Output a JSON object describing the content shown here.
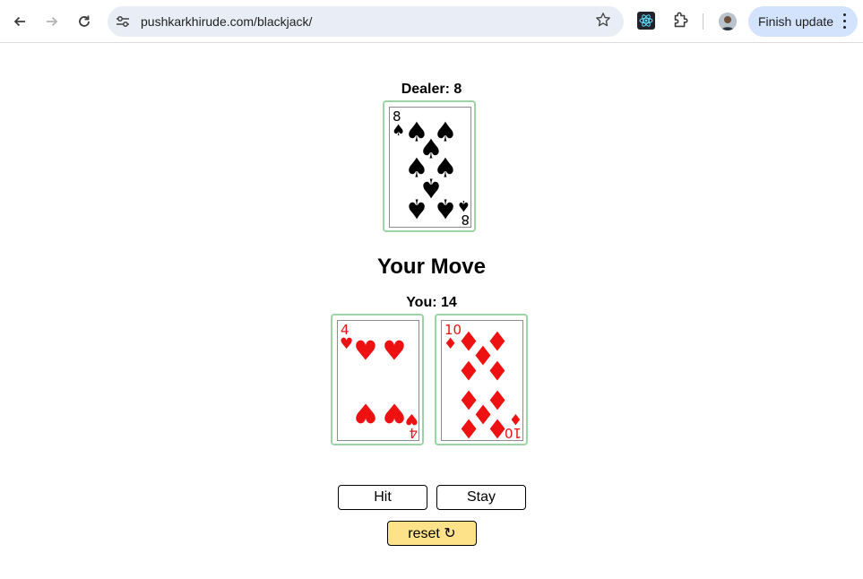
{
  "browser": {
    "url": "pushkarkhirude.com/blackjack/",
    "finish_update_label": "Finish update",
    "icons": [
      "back-icon",
      "forward-icon",
      "reload-icon",
      "site-settings-icon",
      "star-icon",
      "react-devtools-icon",
      "extensions-icon",
      "avatar",
      "more-icon"
    ]
  },
  "game": {
    "dealer_label": "Dealer: 8",
    "status": "Your Move",
    "player_label": "You: 14",
    "dealer_cards": [
      {
        "rank": "8",
        "suit": "spades"
      }
    ],
    "player_cards": [
      {
        "rank": "4",
        "suit": "hearts"
      },
      {
        "rank": "10",
        "suit": "diamonds"
      }
    ],
    "buttons": {
      "hit": "Hit",
      "stay": "Stay",
      "reset": "reset ↻"
    }
  },
  "colors": {
    "card_border": "#9bd5a6",
    "red_suit": "#ee1111",
    "black_suit": "#000000",
    "reset_bg": "#fde28a",
    "omnibox_bg": "#e9eef6",
    "finish_update_bg": "#d3e3fd"
  }
}
